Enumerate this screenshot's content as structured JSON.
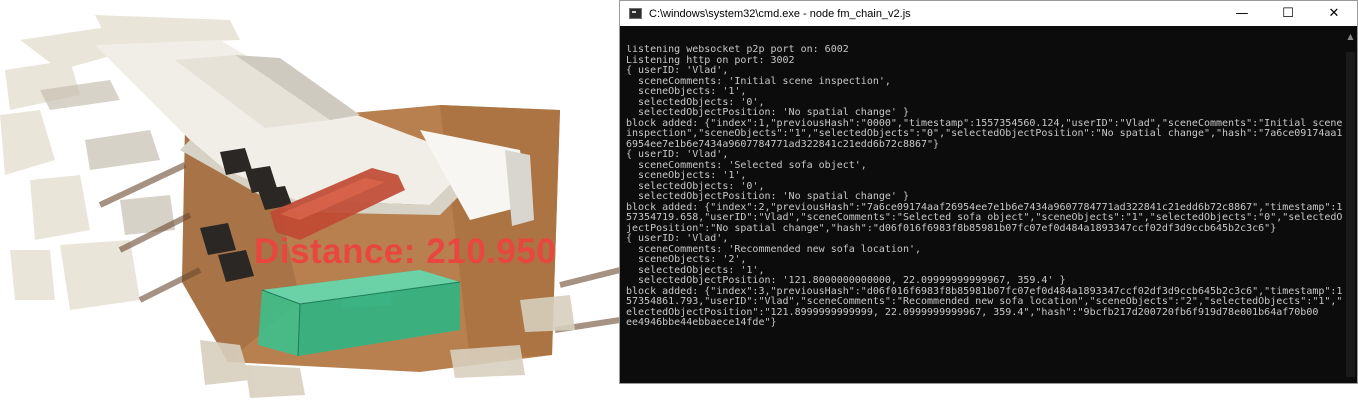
{
  "scene": {
    "distance_label": "Distance: 210.950",
    "colors": {
      "floor": "#b9804f",
      "floor_dark": "#8a5a36",
      "wall": "#f0ede6",
      "sofa_original": "#bf4a33",
      "sofa_placement": "#3fbe8a",
      "label": "#e8463e"
    }
  },
  "console": {
    "title": "C:\\windows\\system32\\cmd.exe - node  fm_chain_v2.js",
    "icons": {
      "minimize": "minimize-icon",
      "maximize": "maximize-icon",
      "close": "close-icon"
    },
    "lines": [
      "listening websocket p2p port on: 6002",
      "Listening http on port: 3002",
      "{ userID: 'Vlad',",
      "  sceneComments: 'Initial scene inspection',",
      "  sceneObjects: '1',",
      "  selectedObjects: '0',",
      "  selectedObjectPosition: 'No spatial change' }",
      "block added: {\"index\":1,\"previousHash\":\"0000\",\"timestamp\":1557354560.124,\"userID\":\"Vlad\",\"sceneComments\":\"Initial scene",
      "inspection\",\"sceneObjects\":\"1\",\"selectedObjects\":\"0\",\"selectedObjectPosition\":\"No spatial change\",\"hash\":\"7a6ce09174aa12",
      "6954ee7e1b6e7434a9607784771ad322841c21edd6b72c8867\"}",
      "{ userID: 'Vlad',",
      "  sceneComments: 'Selected sofa object',",
      "  sceneObjects: '1',",
      "  selectedObjects: '0',",
      "  selectedObjectPosition: 'No spatial change' }",
      "block added: {\"index\":2,\"previousHash\":\"7a6ce09174aaf26954ee7e1b6e7434a9607784771ad322841c21edd6b72c8867\",\"timestamp\":15",
      "57354719.658,\"userID\":\"Vlad\",\"sceneComments\":\"Selected sofa object\",\"sceneObjects\":\"1\",\"selectedObjects\":\"0\",\"selectedOb",
      "jectPosition\":\"No spatial change\",\"hash\":\"d06f016f6983f8b85981b07fc07ef0d484a1893347ccf02df3d9ccb645b2c3c6\"}",
      "{ userID: 'Vlad',",
      "  sceneComments: 'Recommended new sofa location',",
      "  sceneObjects: '2',",
      "  selectedObjects: '1',",
      "  selectedObjectPosition: '121.8000000000000, 22.09999999999967, 359.4' }",
      "block added: {\"index\":3,\"previousHash\":\"d06f016f6983f8b85981b07fc07ef0d484a1893347ccf02df3d9ccb645b2c3c6\",\"timestamp\":15",
      "57354861.793,\"userID\":\"Vlad\",\"sceneComments\":\"Recommended new sofa location\",\"sceneObjects\":\"2\",\"selectedObjects\":\"1\",\"s",
      "electedObjectPosition\":\"121.8999999999999, 22.0999999999967, 359.4\",\"hash\":\"9bcfb217d200720fb6f919d78e001b64af70b00",
      "ee4946bbe44ebbaece14fde\"}"
    ]
  }
}
